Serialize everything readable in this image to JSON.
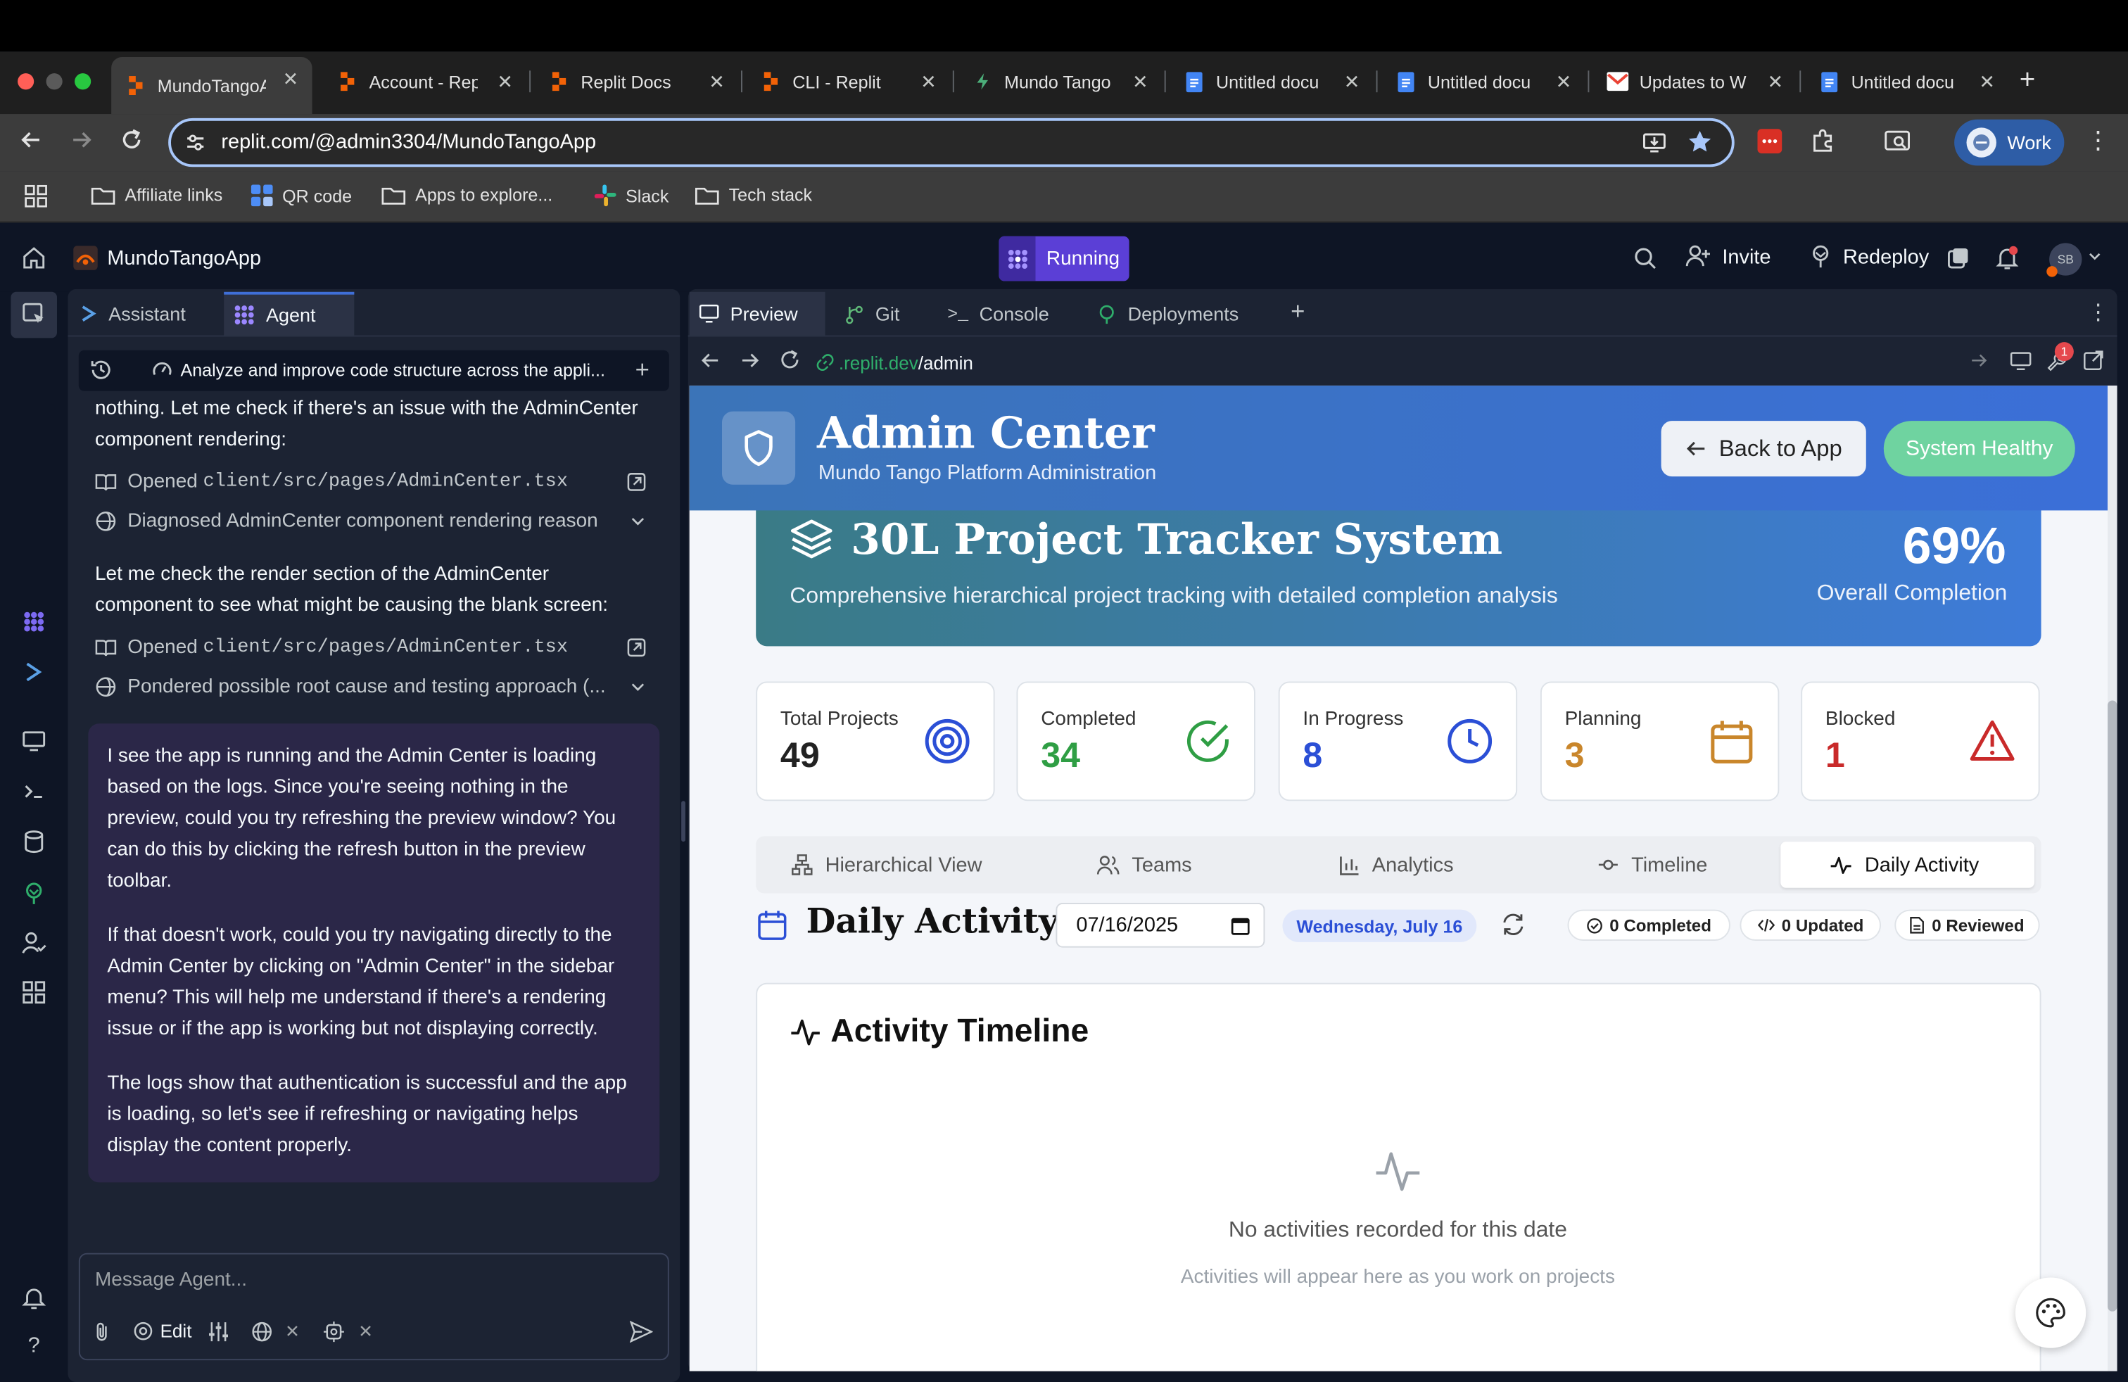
{
  "browser": {
    "tabs": [
      {
        "title": "MundoTangoA",
        "icon": "replit"
      },
      {
        "title": "Account - Rep",
        "icon": "replit"
      },
      {
        "title": "Replit Docs",
        "icon": "replit"
      },
      {
        "title": "CLI - Replit",
        "icon": "replit"
      },
      {
        "title": "Mundo Tango",
        "icon": "mundo-tango"
      },
      {
        "title": "Untitled docu",
        "icon": "google-docs"
      },
      {
        "title": "Untitled docu",
        "icon": "google-docs"
      },
      {
        "title": "Updates to W",
        "icon": "gmail"
      },
      {
        "title": "Untitled docu",
        "icon": "google-docs"
      }
    ],
    "url": "replit.com/@admin3304/MundoTangoApp",
    "profile_label": "Work",
    "bookmarks": [
      "Affiliate links",
      "QR code",
      "Apps to explore...",
      "Slack",
      "Tech stack"
    ]
  },
  "replit": {
    "app_name": "MundoTangoApp",
    "run_status": "Running",
    "invite_label": "Invite",
    "redeploy_label": "Redeploy",
    "avatar_initials": "SB",
    "left_tabs": [
      "Assistant",
      "Agent"
    ],
    "right_tabs": [
      "Preview",
      "Git",
      "Console",
      "Deployments"
    ],
    "task_title": "Analyze and improve code structure across the appli...",
    "preview_url_host": ".replit.dev",
    "preview_url_path": "/admin",
    "preview_badge": "1",
    "chat": {
      "intro_lines": [
        "nothing. Let me check if there's an issue with the AdminCenter",
        "component rendering:"
      ],
      "step1_prefix": "Opened",
      "step1_path": "client/src/pages/AdminCenter.tsx",
      "step2": "Diagnosed AdminCenter component rendering reason",
      "mid_lines": [
        "Let me check the render section of the AdminCenter",
        "component to see what might be causing the blank screen:"
      ],
      "step3_prefix": "Opened",
      "step3_path": "client/src/pages/AdminCenter.tsx",
      "step4": "Pondered possible root cause and testing approach (...",
      "bubble_p1": [
        "I see the app is running and the Admin Center is loading",
        "based on the logs. Since you're seeing nothing in the",
        "preview, could you try refreshing the preview window? You",
        "can do this by clicking the refresh button in the preview",
        "toolbar."
      ],
      "bubble_p2": [
        "If that doesn't work, could you try navigating directly to the",
        "Admin Center by clicking on \"Admin Center\" in the sidebar",
        "menu? This will help me understand if there's a rendering",
        "issue or if the app is working but not displaying correctly."
      ],
      "bubble_p3": [
        "The logs show that authentication is successful and the app",
        "is loading, so let's see if refreshing or navigating helps",
        "display the content properly."
      ],
      "input_placeholder": "Message Agent...",
      "edit_label": "Edit"
    }
  },
  "admin": {
    "title": "Admin Center",
    "subtitle": "Mundo Tango Platform Administration",
    "back_label": "Back to App",
    "health_label": "System Healthy",
    "project_title": "30L Project Tracker System",
    "project_subtitle": "Comprehensive hierarchical project tracking with detailed completion analysis",
    "completion_value": "69%",
    "completion_label": "Overall Completion",
    "stats": [
      {
        "label": "Total Projects",
        "value": "49",
        "color": "#222222",
        "icon": "target-icon",
        "icon_color": "#2b4fd6"
      },
      {
        "label": "Completed",
        "value": "34",
        "color": "#2f9e44",
        "icon": "check-circle-icon",
        "icon_color": "#2f9e44"
      },
      {
        "label": "In Progress",
        "value": "8",
        "color": "#2b4fd6",
        "icon": "clock-icon",
        "icon_color": "#2b4fd6"
      },
      {
        "label": "Planning",
        "value": "3",
        "color": "#c9862b",
        "icon": "calendar-icon",
        "icon_color": "#c9862b"
      },
      {
        "label": "Blocked",
        "value": "1",
        "color": "#c92a2a",
        "icon": "alert-triangle-icon",
        "icon_color": "#c92a2a"
      }
    ],
    "view_tabs": [
      "Hierarchical View",
      "Teams",
      "Analytics",
      "Timeline",
      "Daily Activity"
    ],
    "active_view_tab": "Daily Activity",
    "daily": {
      "title": "Daily Activity",
      "date_value": "07/16/2025",
      "date_badge": "Wednesday, July 16",
      "completed_pill": "0 Completed",
      "updated_pill": "0 Updated",
      "reviewed_pill": "0 Reviewed",
      "timeline_title": "Activity Timeline",
      "empty_title": "No activities recorded for this date",
      "empty_sub": "Activities will appear here as you work on projects"
    }
  },
  "colors": {
    "replit_orange": "#f26207",
    "running_purple": "#5b3fd6",
    "health_green": "#6fd3a0",
    "header_blue": "#3b6fd8"
  }
}
